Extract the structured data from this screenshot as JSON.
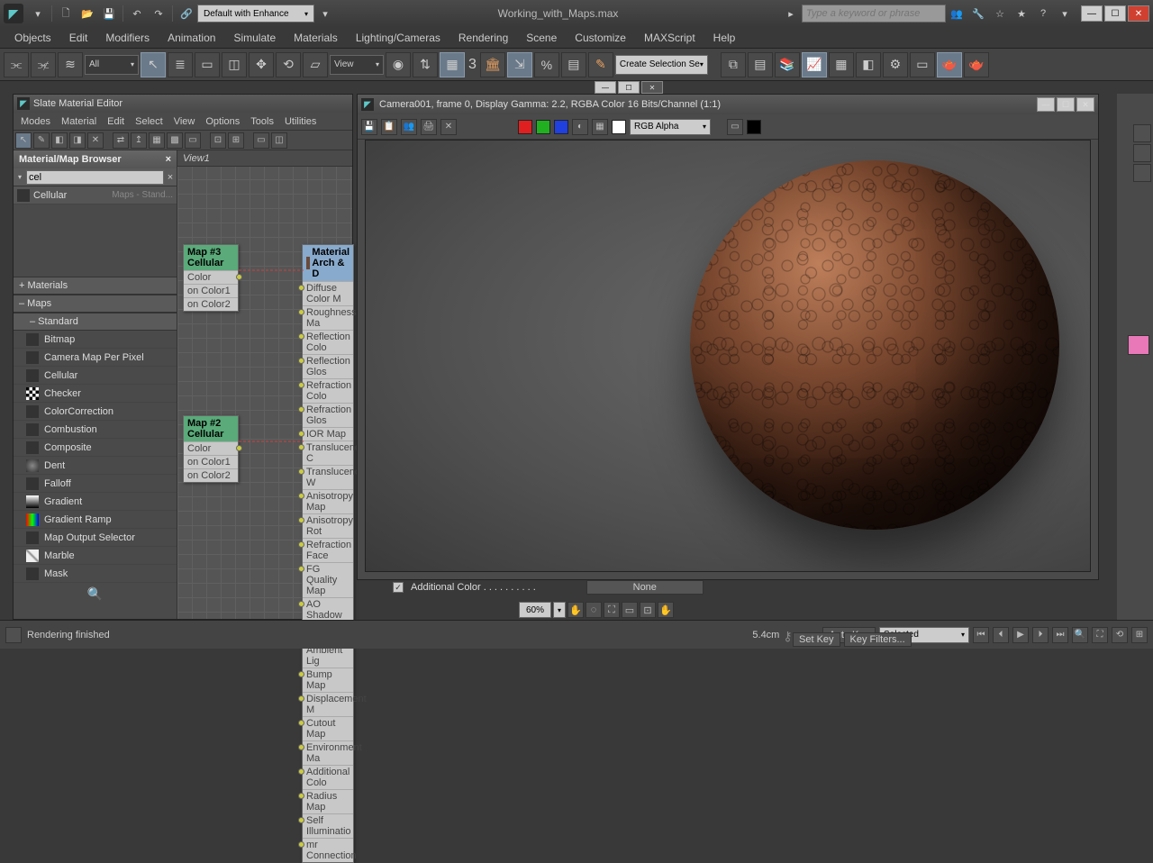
{
  "title": "Working_with_Maps.max",
  "workspace": "Default with Enhance",
  "search_placeholder": "Type a keyword or phrase",
  "menubar": [
    "Objects",
    "Edit",
    "Modifiers",
    "Animation",
    "Simulate",
    "Materials",
    "Lighting/Cameras",
    "Rendering",
    "Scene",
    "Customize",
    "MAXScript",
    "Help"
  ],
  "toolbar": {
    "combo_all": "All",
    "combo_view": "View",
    "sel_set": "Create Selection Se",
    "three": "3"
  },
  "slate": {
    "title": "Slate Material Editor",
    "menus": [
      "Modes",
      "Material",
      "Edit",
      "Select",
      "View",
      "Options",
      "Tools",
      "Utilities"
    ],
    "browser": {
      "title": "Material/Map Browser",
      "search": "cel",
      "result": {
        "name": "Cellular",
        "cat": "Maps - Stand..."
      }
    },
    "cats": {
      "materials": "+ Materials",
      "maps": "– Maps",
      "standard": "– Standard"
    },
    "maps": [
      "Bitmap",
      "Camera Map Per Pixel",
      "Cellular",
      "Checker",
      "ColorCorrection",
      "Combustion",
      "Composite",
      "Dent",
      "Falloff",
      "Gradient",
      "Gradient Ramp",
      "Map Output Selector",
      "Marble",
      "Mask"
    ],
    "view": "View1",
    "node1": {
      "title": "Map #3",
      "sub": "Cellular",
      "rows": [
        "Color",
        "on Color1",
        "on Color2"
      ]
    },
    "node2": {
      "title": "Map #2",
      "sub": "Cellular",
      "rows": [
        "Color",
        "on Color1",
        "on Color2"
      ]
    },
    "matnode": {
      "title": "Material",
      "sub": "Arch & D",
      "rows": [
        "Diffuse Color M",
        "Roughness Ma",
        "Reflection Colo",
        "Reflection Glos",
        "Refraction Colo",
        "Refraction Glos",
        "IOR Map",
        "Translucency C",
        "Translucency W",
        "Anisotropy Map",
        "Anisotropy Rot",
        "Refraction Face",
        "FG Quality Map",
        "AO Shadow Co",
        "AO Ambient Lig",
        "Bump Map",
        "Displacement M",
        "Cutout Map",
        "Environment Ma",
        "Additional Colo",
        "Radius Map",
        "Self Illuminatio",
        "mr Connection"
      ]
    }
  },
  "render": {
    "title": "Camera001, frame 0, Display Gamma: 2.2, RGBA Color 16 Bits/Channel (1:1)",
    "alpha": "RGB Alpha"
  },
  "addcolor": {
    "label": "Additional Color . . . . . . . . . .",
    "none": "None"
  },
  "btm": {
    "pct": "60%"
  },
  "status": {
    "msg": "Rendering finished",
    "coord": "5.4cm",
    "autokey": "Auto Key",
    "setkey": "Set Key",
    "selected": "Selected",
    "keyfilters": "Key Filters..."
  }
}
